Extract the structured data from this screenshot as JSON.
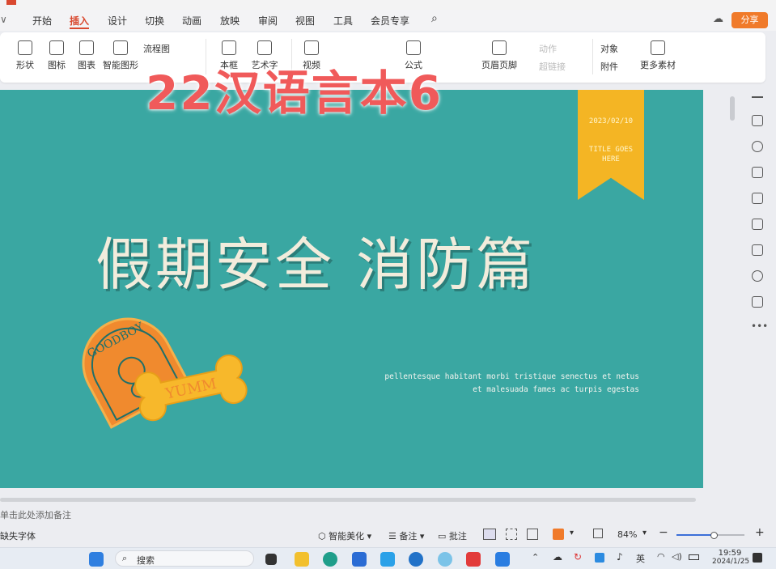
{
  "menu": {
    "tabs": [
      "开始",
      "插入",
      "设计",
      "切换",
      "动画",
      "放映",
      "审阅",
      "视图",
      "工具",
      "会员专享"
    ],
    "active_tab": "插入",
    "share_label": "分享"
  },
  "ribbon": {
    "items": [
      "形状",
      "图标",
      "图表",
      "智能图形",
      "流程图",
      "本框",
      "艺术字",
      "视频",
      "公式",
      "页眉页脚",
      "动作",
      "超链接",
      "对象",
      "附件",
      "更多素材"
    ]
  },
  "overlay_text": "22汉语言本6",
  "slide": {
    "date": "2023/02/10",
    "tag_title_line1": "TITLE GOES",
    "tag_title_line2": "HERE",
    "main_title": "假期安全 消防篇",
    "subtitle_line1": "pellentesque habitant morbi tristique senectus et netus",
    "subtitle_line2": "et malesuada fames ac turpis egestas",
    "sticker_top_text": "GOODBOY",
    "sticker_bone_text": "YUMM",
    "colors": {
      "background": "#3aa7a2",
      "ribbon": "#f4b524",
      "badge": "#f08a2e",
      "bone": "#f7b82b"
    }
  },
  "notes_placeholder": "单击此处添加备注",
  "status": {
    "font_missing": "缺失字体",
    "smart_beautify": "智能美化",
    "notes": "备注",
    "comments": "批注",
    "zoom": "84%",
    "zoom_level": 0.55
  },
  "taskbar": {
    "search_label": "搜索",
    "input_method": "英",
    "time": "19:59",
    "date": "2024/1/25"
  }
}
